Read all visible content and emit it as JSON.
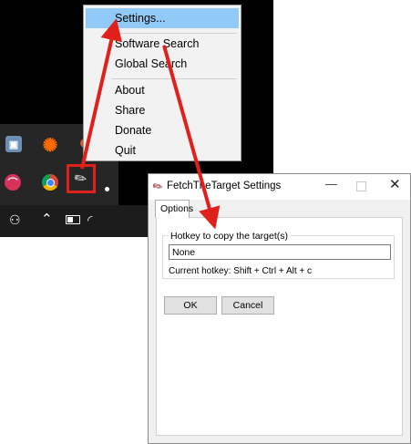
{
  "context_menu": {
    "items": [
      {
        "label": "Settings..."
      },
      {
        "label": "Software Search"
      },
      {
        "label": "Global Search"
      },
      {
        "label": "About"
      },
      {
        "label": "Share"
      },
      {
        "label": "Donate"
      },
      {
        "label": "Quit"
      }
    ],
    "highlighted_index": 0
  },
  "tray": {
    "icons": [
      "monitor-icon",
      "avast-icon",
      "orange-app-icon",
      "pink-app-icon",
      "chrome-icon",
      "fetchthetarget-tray-icon"
    ]
  },
  "taskbar": {
    "icons": [
      "people-icon",
      "chevron-up-icon",
      "battery-icon",
      "wifi-icon"
    ]
  },
  "dialog": {
    "title": "FetchTheTarget Settings",
    "tab_label": "Options",
    "group_label": "Hotkey to copy the target(s)",
    "hotkey_value": "None",
    "current_hotkey": "Current hotkey: Shift + Ctrl + Alt + c",
    "ok_label": "OK",
    "cancel_label": "Cancel"
  },
  "colors": {
    "highlight": "#91c9f7",
    "annotation_red": "#e0201b",
    "menu_bg": "#f2f2f2",
    "dialog_bg": "#f0f0f0"
  }
}
